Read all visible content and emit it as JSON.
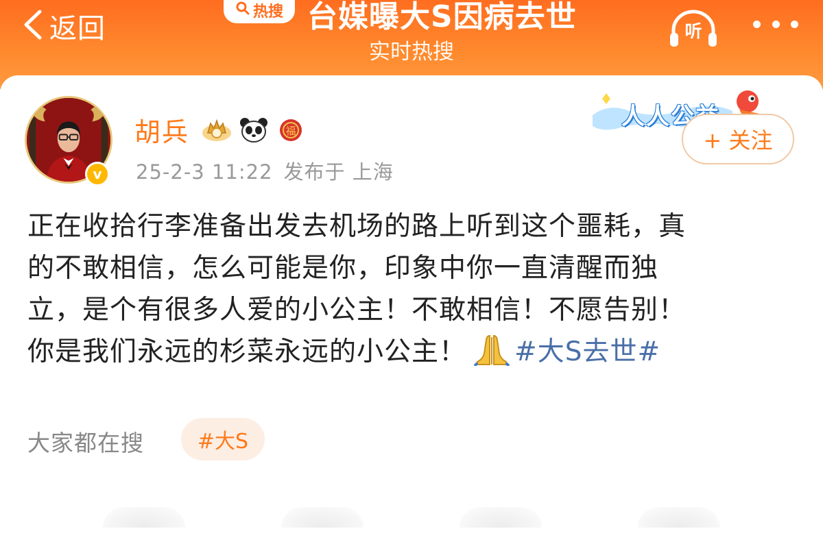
{
  "header": {
    "back_label": "返回",
    "hot_badge": "热搜",
    "headline": "台媒曝大S因病去世",
    "subtitle": "实时热搜",
    "listen_label": "听"
  },
  "post": {
    "username": "胡兵",
    "timestamp": "25-2-3 11:22",
    "location": "发布于 上海",
    "campaign_label": "人人公益",
    "follow_label": "+ 关注",
    "lines": [
      "正在收拾行李准备出发去机场的路上听到这个噩耗，真",
      "的不敢相信，怎么可能是你，印象中你一直清醒而独",
      "立，是个有很多人爱的小公主！不敢相信！不愿告别！",
      "你是我们永远的杉菜永远的小公主！"
    ],
    "hashtag": "#大S去世#"
  },
  "related": {
    "label": "大家都在搜",
    "chip": "#大S"
  },
  "colors": {
    "brand_orange": "#ff6d1f",
    "username": "#ff7a1a",
    "hashtag": "#4a6fa8",
    "meta_gray": "#999999"
  },
  "icons": [
    "back-chevron-icon",
    "search-icon",
    "headphones-icon",
    "more-dots-icon",
    "verified-icon",
    "crown-badge-icon",
    "panda-badge-icon",
    "fortune-badge-icon",
    "praying-hands-icon"
  ]
}
